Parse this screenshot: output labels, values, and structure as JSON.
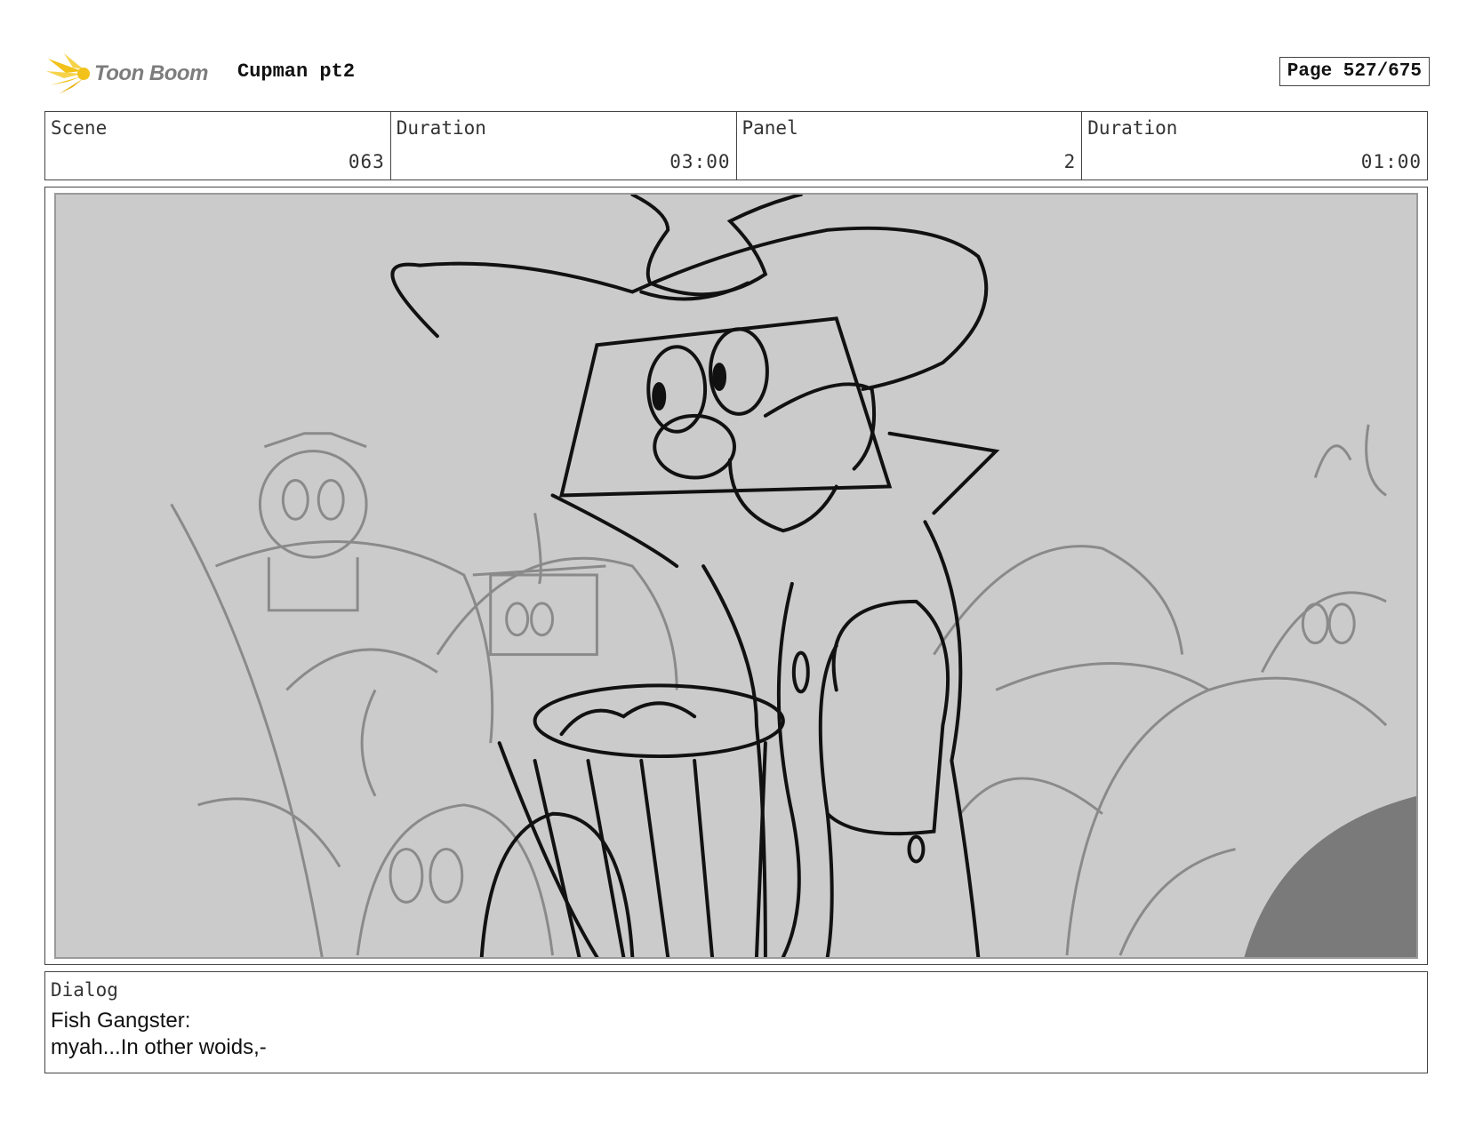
{
  "header": {
    "logo_text": "Toon Boom",
    "project_title": "Cupman pt2",
    "page_label": "Page 527/675"
  },
  "info": {
    "scene_label": "Scene",
    "scene_value": "063",
    "scene_duration_label": "Duration",
    "scene_duration_value": "03:00",
    "panel_label": "Panel",
    "panel_value": "2",
    "panel_duration_label": "Duration",
    "panel_duration_value": "01:00"
  },
  "dialog": {
    "label": "Dialog",
    "speaker": "Fish Gangster:",
    "line": "myah...In other woids,-"
  },
  "colors": {
    "panel_background": "#cbcbcb",
    "logo_gold": "#f2c21b",
    "logo_gray": "#7d7d7d"
  }
}
